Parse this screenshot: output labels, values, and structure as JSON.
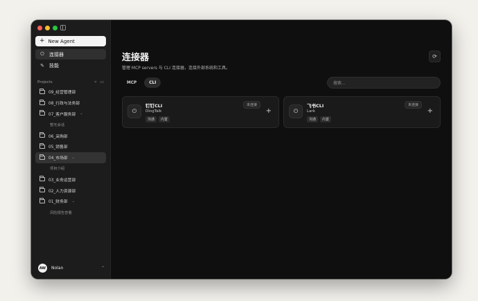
{
  "sidebar": {
    "new_agent_label": "New Agent",
    "nav": [
      {
        "label": "连接器",
        "icon": "plug-icon",
        "active": true
      },
      {
        "label": "技能",
        "icon": "wrench-icon",
        "active": false
      }
    ],
    "projects_label": "Projects",
    "projects": [
      {
        "label": "09_经营管理部"
      },
      {
        "label": "08_行政与法务部"
      },
      {
        "label": "07_客户服务部",
        "expanded": true,
        "children": [
          "暂无会话"
        ]
      },
      {
        "label": "06_采购部"
      },
      {
        "label": "05_销售部"
      },
      {
        "label": "04_市场部",
        "expanded": true,
        "active": true,
        "children": [
          "项目介绍"
        ]
      },
      {
        "label": "03_业务运营部"
      },
      {
        "label": "02_人力资源部"
      },
      {
        "label": "01_财务部",
        "expanded": true,
        "children": [
          "风险报告查看"
        ]
      }
    ],
    "user": {
      "initials": "AW",
      "name": "Nolan"
    }
  },
  "main": {
    "title": "连接器",
    "description": "管理 MCP servers 与 CLI 连接器，连接外部系统和工具。",
    "tabs": [
      {
        "label": "MCP",
        "active": false
      },
      {
        "label": "CLI",
        "active": true
      }
    ],
    "search_placeholder": "搜索...",
    "cards": [
      {
        "title": "钉钉CLI",
        "subtitle": "DingTalk",
        "tags": [
          "沟通",
          "内置"
        ],
        "status": "未连接"
      },
      {
        "title": "飞书CLI",
        "subtitle": "Lark",
        "tags": [
          "沟通",
          "内置"
        ],
        "status": "未连接"
      }
    ]
  }
}
